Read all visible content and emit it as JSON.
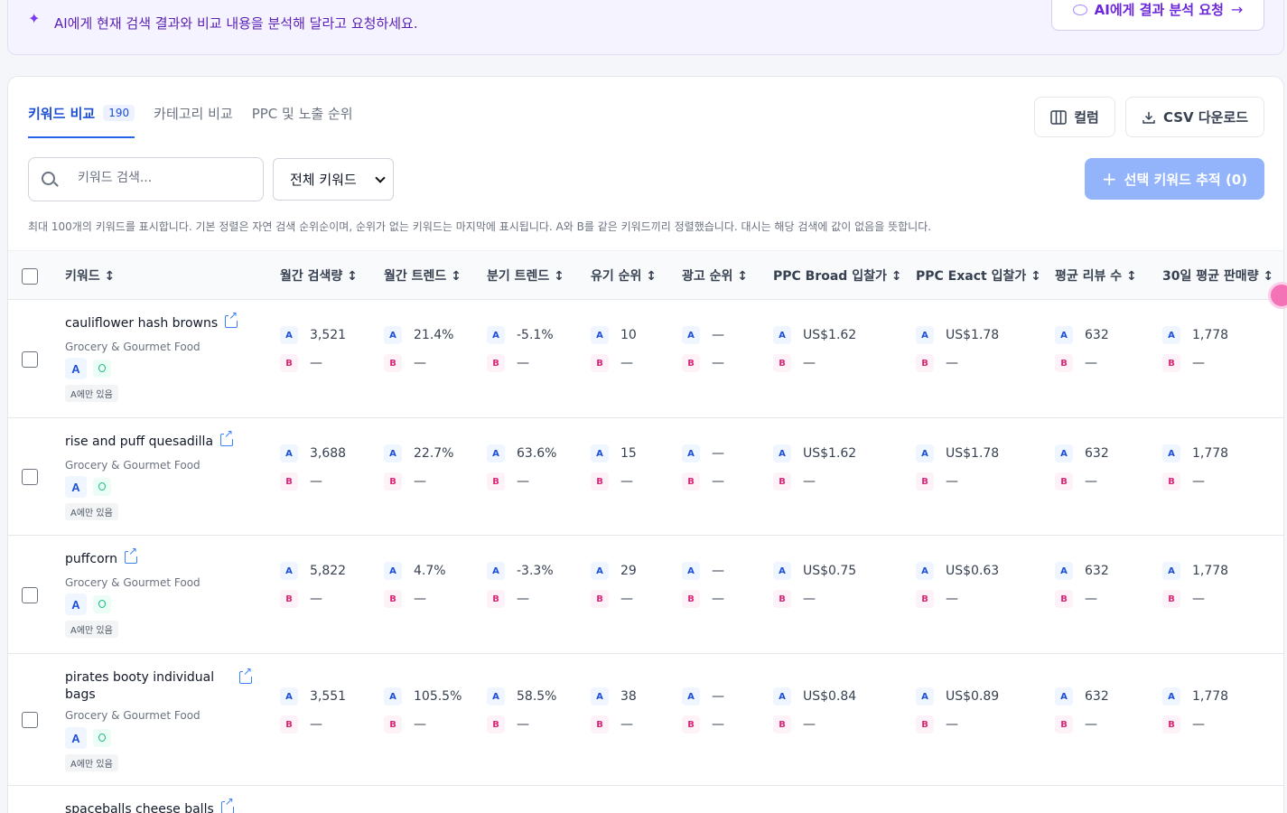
{
  "ai_banner": {
    "text": "AI에게 현재 검색 결과와 비교 내용을 분석해 달라고 요청하세요.",
    "button": "AI에게 결과 분석 요청"
  },
  "tabs": [
    {
      "label": "키워드 비교",
      "count": "190",
      "active": true
    },
    {
      "label": "카테고리 비교"
    },
    {
      "label": "PPC 및 노출 순위"
    }
  ],
  "toolbar": {
    "columns_label": "컬럼",
    "csv_label": "CSV 다운로드",
    "search_placeholder": "키워드 검색...",
    "filter_value": "전체 키워드",
    "track_label": "선택 키워드 추적 (0)",
    "note": "최대 100개의 키워드를 표시합니다. 기본 정렬은 자연 검색 순위순이며, 순위가 없는 키워드는 마지막에 표시됩니다. A와 B를 같은 키워드끼리 정렬했습니다. 대시는 해당 검색에 값이 없음을 뜻합니다."
  },
  "columns": [
    "키워드 ↕",
    "월간 검색량 ↕",
    "월간 트렌드 ↕",
    "분기 트렌드 ↕",
    "유기 순위 ↕",
    "광고 순위 ↕",
    "PPC Broad 입찰가 ↕",
    "PPC Exact 입찰가 ↕",
    "평균 리뷰 수 ↕",
    "30일 평균 판매량 ↕"
  ],
  "rows": [
    {
      "keyword": "cauliflower hash browns",
      "category": "Grocery & Gourmet Food",
      "badge": "A",
      "only": "A에만 있음",
      "a": [
        "3,521",
        "21.4%",
        "-5.1%",
        "10",
        "—",
        "US$1.62",
        "US$1.78",
        "632",
        "1,778"
      ],
      "b": [
        "—",
        "—",
        "—",
        "—",
        "—",
        "—",
        "—",
        "—",
        "—"
      ]
    },
    {
      "keyword": "rise and puff quesadilla",
      "category": "Grocery & Gourmet Food",
      "badge": "A",
      "only": "A에만 있음",
      "a": [
        "3,688",
        "22.7%",
        "63.6%",
        "15",
        "—",
        "US$1.62",
        "US$1.78",
        "632",
        "1,778"
      ],
      "b": [
        "—",
        "—",
        "—",
        "—",
        "—",
        "—",
        "—",
        "—",
        "—"
      ]
    },
    {
      "keyword": "puffcorn",
      "category": "Grocery & Gourmet Food",
      "badge": "A",
      "only": "A에만 있음",
      "a": [
        "5,822",
        "4.7%",
        "-3.3%",
        "29",
        "—",
        "US$0.75",
        "US$0.63",
        "632",
        "1,778"
      ],
      "b": [
        "—",
        "—",
        "—",
        "—",
        "—",
        "—",
        "—",
        "—",
        "—"
      ]
    },
    {
      "keyword_line1": "pirates booty individual",
      "keyword_line2": "bags",
      "category": "Grocery & Gourmet Food",
      "badge": "A",
      "only": "A에만 있음",
      "a": [
        "3,551",
        "105.5%",
        "58.5%",
        "38",
        "—",
        "US$0.84",
        "US$0.89",
        "632",
        "1,778"
      ],
      "b": [
        "—",
        "—",
        "—",
        "—",
        "—",
        "—",
        "—",
        "—",
        "—"
      ]
    },
    {
      "keyword": "spaceballs cheese balls"
    }
  ],
  "tag_a": "A",
  "tag_b": "B",
  "colors": {
    "accent": "#2563eb",
    "ai": "#6d28d9",
    "tag_b": "#db2777"
  }
}
